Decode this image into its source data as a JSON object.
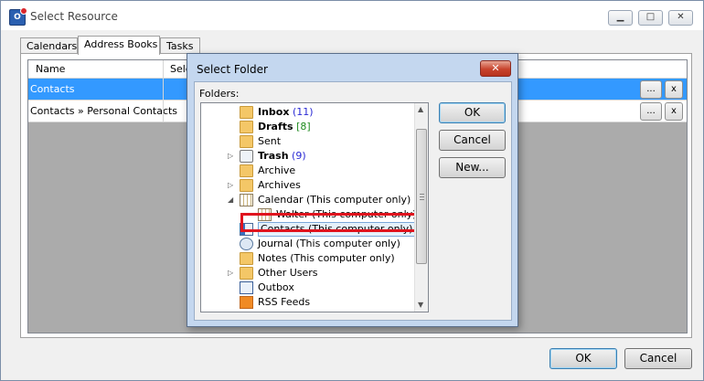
{
  "window": {
    "title": "Select Resource",
    "app_icon_text": "O",
    "controls": {
      "minimize": "▁",
      "maximize": "□",
      "close": "✕"
    }
  },
  "tabs": [
    {
      "label": "Calendars"
    },
    {
      "label": "Address Books",
      "active": true
    },
    {
      "label": "Tasks"
    }
  ],
  "grid": {
    "columns": [
      "Name",
      "Sele"
    ],
    "rows": [
      {
        "name": "Contacts",
        "selected": true,
        "browse": "...",
        "remove": "x"
      },
      {
        "name": "Contacts » Personal Contacts",
        "selected": false,
        "browse": "...",
        "remove": "x"
      }
    ]
  },
  "footer": {
    "ok": "OK",
    "cancel": "Cancel"
  },
  "dialog": {
    "title": "Select Folder",
    "close": "✕",
    "folders_label": "Folders:",
    "buttons": {
      "ok": "OK",
      "cancel": "Cancel",
      "new": "New..."
    },
    "tree": [
      {
        "label": "Inbox",
        "bold": true,
        "count": "(11)",
        "count_color": "#2a2ad4",
        "icon": "inbox-icon"
      },
      {
        "label": "Drafts",
        "bold": true,
        "count": "[8]",
        "count_color": "#1f8a1f",
        "icon": "drafts-icon"
      },
      {
        "label": "Sent",
        "bold": false,
        "icon": "sent-icon"
      },
      {
        "label": "Trash",
        "bold": true,
        "count": "(9)",
        "count_color": "#2a2ad4",
        "icon": "trash-icon",
        "expander": "collapsed"
      },
      {
        "label": "Archive",
        "bold": false,
        "icon": "folder-icon"
      },
      {
        "label": "Archives",
        "bold": false,
        "icon": "folder-icon",
        "expander": "collapsed"
      },
      {
        "label": "Calendar (This computer only)",
        "bold": false,
        "icon": "calendar-icon",
        "expander": "expanded"
      },
      {
        "label": "Walter (This computer only)",
        "bold": false,
        "icon": "calendar-icon"
      },
      {
        "label": "Contacts (This computer only)",
        "bold": false,
        "icon": "contacts-icon",
        "selected": true
      },
      {
        "label": "Journal (This computer only)",
        "bold": false,
        "icon": "journal-icon"
      },
      {
        "label": "Notes (This computer only)",
        "bold": false,
        "icon": "notes-icon"
      },
      {
        "label": "Other Users",
        "bold": false,
        "icon": "folder-icon",
        "expander": "collapsed"
      },
      {
        "label": "Outbox",
        "bold": false,
        "icon": "outbox-icon"
      },
      {
        "label": "RSS Feeds",
        "bold": false,
        "icon": "rss-icon"
      }
    ]
  }
}
